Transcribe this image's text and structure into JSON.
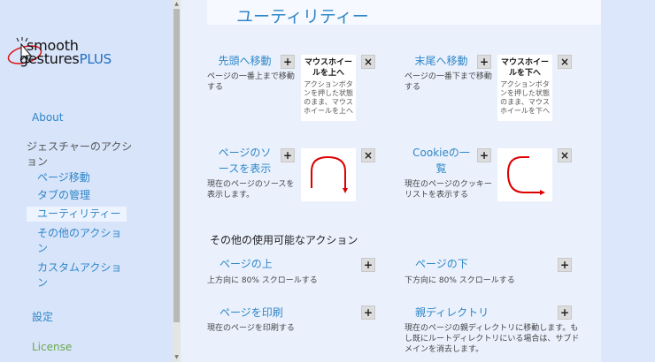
{
  "sidebar": {
    "logo": {
      "line1": "smooth",
      "line2": "gestures",
      "plus": "PLUS"
    },
    "about": "About",
    "gesture_actions": "ジェスチャーのアクション",
    "sub_items": [
      "ページ移動",
      "タブの管理",
      "ユーティリティー",
      "その他のアクション",
      "カスタムアクション"
    ],
    "settings": "設定",
    "license": "License"
  },
  "main": {
    "title": "ユーティリティー",
    "actions": [
      {
        "title": "先頭へ移動",
        "desc": "ページの一番上まで移動する",
        "gesture_title": "マウスホイールを上へ",
        "gesture_desc": "アクションボタンを押した状態のまま、マウスホイールを上へ"
      },
      {
        "title": "末尾へ移動",
        "desc": "ページの一番下まで移動する",
        "gesture_title": "マウスホイールを下へ",
        "gesture_desc": "アクションボタンを押した状態のまま、マウスホイールを下へ"
      },
      {
        "title": "ページのソースを表示",
        "desc": "現在のページのソースを表示します。"
      },
      {
        "title": "Cookieの一覧",
        "desc": "現在のページのクッキーリストを表示する"
      }
    ],
    "other_heading": "その他の使用可能なアクション",
    "other_actions": [
      {
        "title": "ページの上",
        "desc": "上方向に 80% スクロールする"
      },
      {
        "title": "ページの下",
        "desc": "下方向に 80% スクロールする"
      },
      {
        "title": "ページを印刷",
        "desc": "現在のページを印刷する"
      },
      {
        "title": "親ディレクトリ",
        "desc": "現在のページの親ディレクトリに移動します。もし既にルートディレクトリにいる場合は、サブドメインを消去します。"
      }
    ],
    "add_label": "+",
    "remove_label": "×"
  },
  "colors": {
    "accent": "#2f86c8",
    "gesture_stroke": "#dd0000",
    "sidebar_bg": "#d8e4fa"
  },
  "icons": {
    "add": "plus-icon",
    "remove": "close-icon",
    "cursor": "cursor-icon"
  }
}
